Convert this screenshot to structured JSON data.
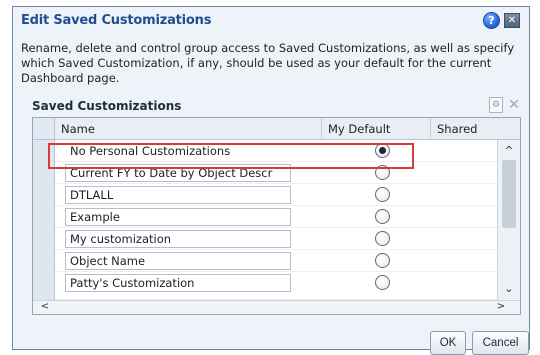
{
  "dialog": {
    "title": "Edit Saved Customizations",
    "help_glyph": "?",
    "close_glyph": "✕",
    "description": "Rename, delete and control group access to Saved Customizations, as well as specify which Saved Customization, if any, should be used as your default for the current Dashboard page.",
    "section_title": "Saved Customizations"
  },
  "table": {
    "columns": [
      "Name",
      "My Default",
      "Shared"
    ],
    "rows": [
      {
        "name": "No Personal Customizations",
        "default": true
      },
      {
        "name": "Current FY to Date by Object Descr",
        "default": false
      },
      {
        "name": "DTLALL",
        "default": false
      },
      {
        "name": "Example",
        "default": false
      },
      {
        "name": "My customization",
        "default": false
      },
      {
        "name": "Object Name",
        "default": false
      },
      {
        "name": "Patty's Customization",
        "default": false
      }
    ]
  },
  "buttons": {
    "ok": "OK",
    "cancel": "Cancel"
  },
  "icons": {
    "help": "help-icon",
    "close": "close-icon",
    "toolbar_a": "edit-access-icon",
    "toolbar_b": "delete-icon"
  },
  "colors": {
    "title": "#1e4f92",
    "highlight_border": "#d83a3a",
    "dialog_bg": "#eef3f9"
  }
}
